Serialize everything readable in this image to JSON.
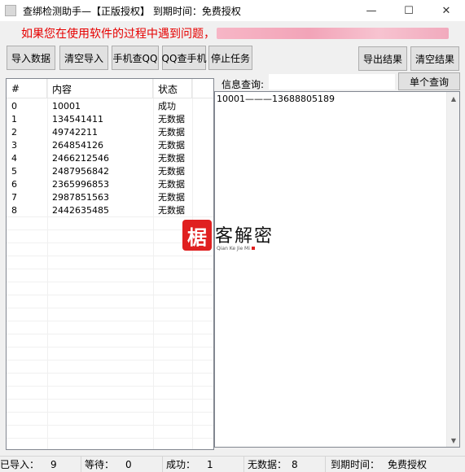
{
  "window": {
    "title": "查绑检测助手—【正版授权】 到期时间：免费授权"
  },
  "notice": {
    "text": "如果您在使用软件的过程中遇到问题，"
  },
  "toolbar": {
    "import_label": "导入数据",
    "clear_import_label": "清空导入",
    "phone_to_qq_label": "手机查QQ",
    "qq_to_phone_label": "QQ查手机",
    "stop_label": "停止任务",
    "export_label": "导出结果",
    "clear_result_label": "清空结果"
  },
  "list": {
    "headers": [
      "#",
      "内容",
      "状态"
    ],
    "rows": [
      {
        "idx": "0",
        "content": "10001",
        "status": "成功"
      },
      {
        "idx": "1",
        "content": "134541411",
        "status": "无数据"
      },
      {
        "idx": "2",
        "content": "49742211",
        "status": "无数据"
      },
      {
        "idx": "3",
        "content": "264854126",
        "status": "无数据"
      },
      {
        "idx": "4",
        "content": "2466212546",
        "status": "无数据"
      },
      {
        "idx": "5",
        "content": "2487956842",
        "status": "无数据"
      },
      {
        "idx": "6",
        "content": "2365996853",
        "status": "无数据"
      },
      {
        "idx": "7",
        "content": "2987851563",
        "status": "无数据"
      },
      {
        "idx": "8",
        "content": "2442635485",
        "status": "无数据"
      }
    ]
  },
  "query": {
    "label": "信息查询:",
    "value": "",
    "button_label": "单个查询"
  },
  "result": {
    "text": "10001———13688805189"
  },
  "watermark": {
    "logo_char": "椐",
    "text": "客解密",
    "sub": "Qian Ke Jie Mi"
  },
  "statusbar": {
    "imported_label": "已导入：",
    "imported_value": "9",
    "waiting_label": "等待：",
    "waiting_value": "0",
    "success_label": "成功：",
    "success_value": "1",
    "nodata_label": "无数据：",
    "nodata_value": "8",
    "expire_label": "到期时间：",
    "expire_value": "免费授权"
  },
  "colors": {
    "notice": "#e60000",
    "button_bg": "#e1e1e1",
    "window_bg": "#f0f0f0"
  }
}
